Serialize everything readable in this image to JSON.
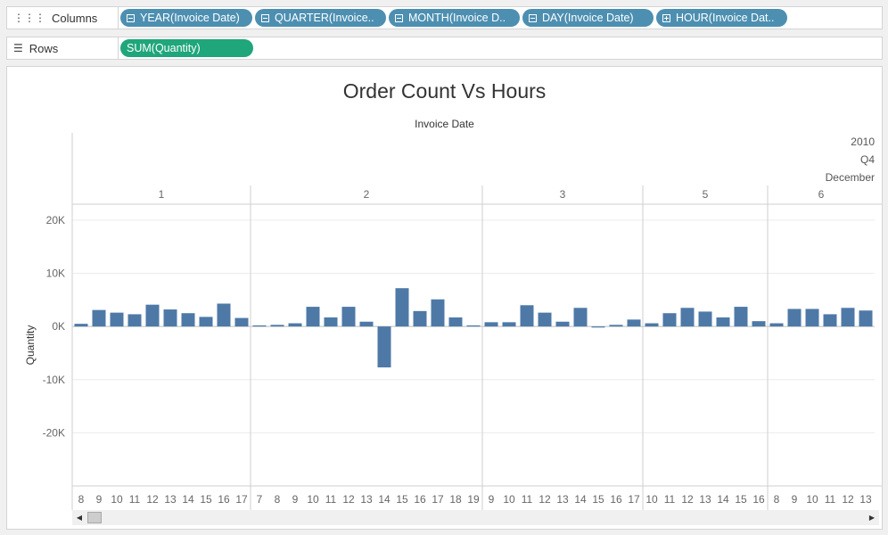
{
  "shelves": {
    "columns": {
      "label": "Columns",
      "icon": "columns-icon",
      "pills": [
        {
          "text": "YEAR(Invoice Date)",
          "sign": "minus"
        },
        {
          "text": "QUARTER(Invoice..",
          "sign": "minus"
        },
        {
          "text": "MONTH(Invoice D..",
          "sign": "minus"
        },
        {
          "text": "DAY(Invoice Date)",
          "sign": "minus"
        },
        {
          "text": "HOUR(Invoice Dat..",
          "sign": "plus"
        }
      ]
    },
    "rows": {
      "label": "Rows",
      "icon": "rows-icon",
      "pill": "SUM(Quantity)"
    }
  },
  "colors": {
    "bar": "#4e79a7",
    "pill_blue": "#4d8fb1",
    "pill_green": "#1fa67a"
  },
  "chart_data": {
    "type": "bar",
    "title": "Order Count Vs Hours",
    "header_title": "Invoice Date",
    "year": "2010",
    "quarter": "Q4",
    "month": "December",
    "ylabel": "Quantity",
    "ylim": [
      -30000,
      23000
    ],
    "yticks": [
      20000,
      10000,
      0,
      -10000,
      -20000
    ],
    "ytick_labels": [
      "20K",
      "10K",
      "0K",
      "-10K",
      "-20K"
    ],
    "grid": true,
    "panes": [
      {
        "day": "1",
        "hours": [
          "8",
          "9",
          "10",
          "11",
          "12",
          "13",
          "14",
          "15",
          "16",
          "17"
        ],
        "values": [
          500,
          3100,
          2600,
          2300,
          4100,
          3200,
          2500,
          1800,
          4300,
          1600
        ]
      },
      {
        "day": "2",
        "hours": [
          "7",
          "8",
          "9",
          "10",
          "11",
          "12",
          "13",
          "14",
          "15",
          "16",
          "17",
          "18",
          "19"
        ],
        "values": [
          200,
          300,
          600,
          3700,
          1700,
          3700,
          900,
          -7700,
          7200,
          2900,
          5100,
          1700,
          200
        ]
      },
      {
        "day": "3",
        "hours": [
          "9",
          "10",
          "11",
          "12",
          "13",
          "14",
          "15",
          "16",
          "17"
        ],
        "values": [
          800,
          800,
          4000,
          2600,
          900,
          3500,
          -200,
          300,
          1300
        ]
      },
      {
        "day": "5",
        "hours": [
          "10",
          "11",
          "12",
          "13",
          "14",
          "15",
          "16"
        ],
        "values": [
          600,
          2500,
          3500,
          2800,
          1700,
          3700,
          1000
        ]
      },
      {
        "day": "6",
        "hours": [
          "8",
          "9",
          "10",
          "11",
          "12",
          "13"
        ],
        "values": [
          600,
          3300,
          3300,
          2300,
          3500,
          3000
        ]
      }
    ]
  }
}
